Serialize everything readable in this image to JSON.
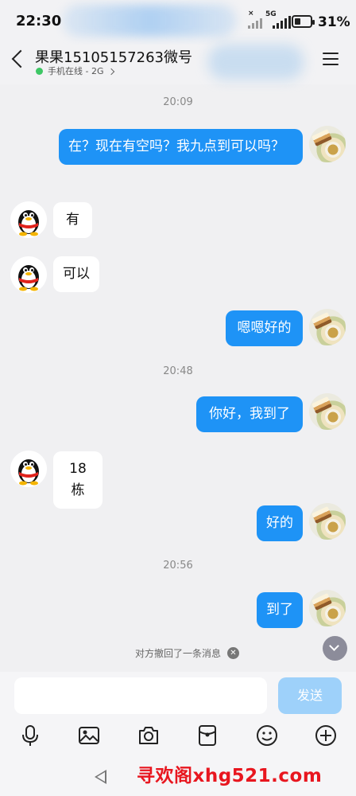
{
  "status_bar": {
    "time": "22:30",
    "network": "5G",
    "battery_percent": "31%"
  },
  "header": {
    "title": "果果15105157263微号",
    "status": "手机在线 - 2G"
  },
  "timestamps": [
    "20:09",
    "20:48",
    "20:56"
  ],
  "messages": [
    {
      "from": "me",
      "text": "在？现在有空吗？我九点到可以吗？"
    },
    {
      "from": "them",
      "text": "有"
    },
    {
      "from": "them",
      "text": "可以"
    },
    {
      "from": "me",
      "text": "嗯嗯好的"
    },
    {
      "from": "me",
      "text": "你好，我到了"
    },
    {
      "from": "them",
      "text": "18栋"
    },
    {
      "from": "me",
      "text": "好的"
    },
    {
      "from": "me",
      "text": "到了"
    }
  ],
  "system_notice": "对方撤回了一条消息",
  "composer": {
    "value": "",
    "send_label": "发送"
  },
  "toolbar_icons": [
    "microphone-icon",
    "image-icon",
    "camera-icon",
    "red-packet-icon",
    "emoji-icon",
    "plus-icon"
  ],
  "watermark": "寻欢阁xhg521.com",
  "colors": {
    "my_bubble": "#1e93f6",
    "their_bubble": "#ffffff",
    "online": "#3ec765",
    "send_disabled": "#9ed1fa",
    "watermark": "#e8161f"
  }
}
